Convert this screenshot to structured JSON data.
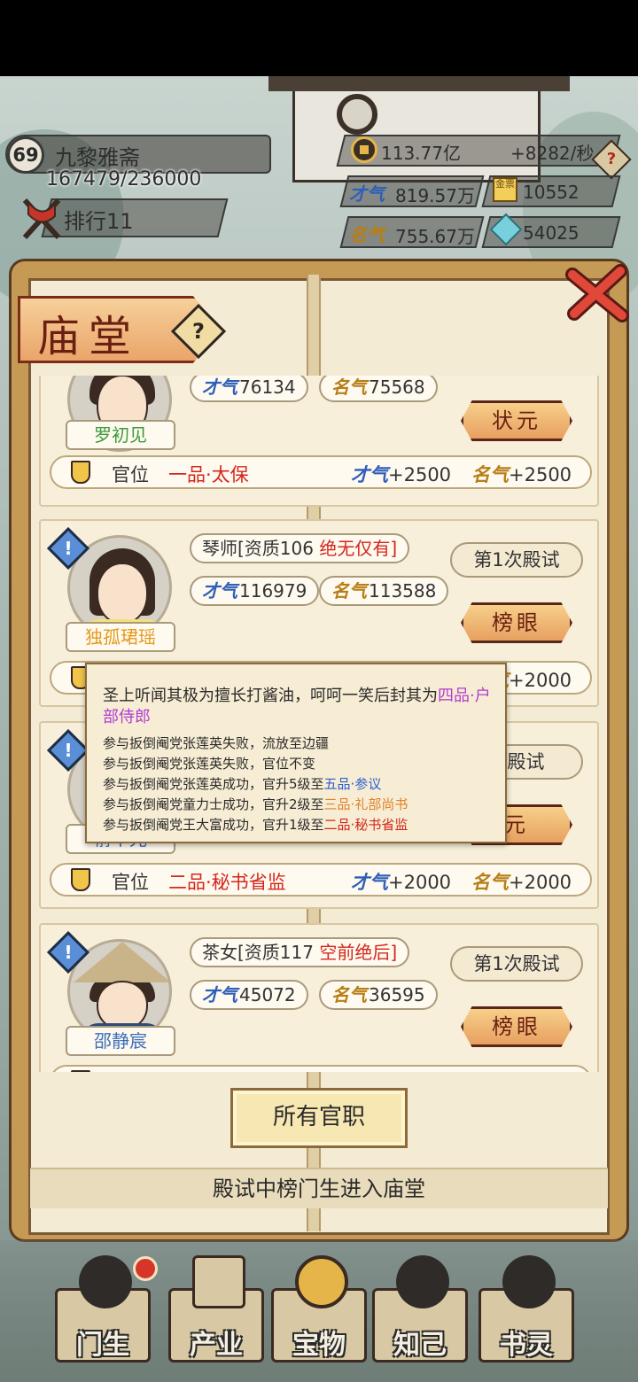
{
  "player": {
    "level": "69",
    "name": "九黎雅斋",
    "exp": "167479/236000",
    "rank": "排行11"
  },
  "resources": {
    "money": "113.77亿",
    "income": "+8282/秒",
    "talent": "819.57万",
    "gold": "10552",
    "fame": "755.67万",
    "gems": "54025"
  },
  "icons": {
    "talent_tag": "才气",
    "fame_tag": "名气",
    "gold_seal": "金票",
    "help": "?",
    "warn": "!"
  },
  "panel": {
    "title": "庙堂",
    "all_positions": "所有官职",
    "footer": "殿试中榜门生进入庙堂"
  },
  "rank_label": "官位",
  "cards": [
    {
      "name": "罗初见",
      "talent": "76134",
      "fame": "75568",
      "honor": "状元",
      "position": "一品·太保",
      "talent_bonus": "+2500",
      "fame_bonus": "+2500"
    },
    {
      "name": "独孤珺瑶",
      "role": "琴师[资质106",
      "quality": "绝无仅有]",
      "exam": "第1次殿试",
      "talent": "116979",
      "fame": "113588",
      "honor": "榜眼",
      "fame_bonus": "+2000"
    },
    {
      "name": "俞华光",
      "exam": "次殿试",
      "honor": "元",
      "position": "二品·秘书省监",
      "talent_bonus": "+2000",
      "fame_bonus": "+2000"
    },
    {
      "name": "邵静宸",
      "role": "茶女[资质117",
      "quality": "空前绝后]",
      "exam": "第1次殿试",
      "talent": "45072",
      "fame": "36595",
      "honor": "榜眼"
    }
  ],
  "tooltip": {
    "main": "圣上听闻其极为擅长打酱油，呵呵一笑后封其为",
    "main_highlight": "四品·户部侍郎",
    "lines": [
      {
        "text": "参与扳倒阉党张莲英失败，流放至边疆",
        "hl": ""
      },
      {
        "text": "参与扳倒阉党张莲英失败，官位不变",
        "hl": ""
      },
      {
        "text": "参与扳倒阉党张莲英成功，官升5级至",
        "hl": "五品·参议"
      },
      {
        "text": "参与扳倒阉党童力士成功，官升2级至",
        "hl": "三品·礼部尚书"
      },
      {
        "text": "参与扳倒阉党王大富成功，官升1级至",
        "hl": "二品·秘书省监"
      }
    ]
  },
  "nav": [
    "门生",
    "产业",
    "宝物",
    "知己",
    "书灵"
  ],
  "colors": {
    "accent_red": "#d4261c",
    "talent_blue": "#2f5fb8",
    "fame_gold": "#b77e16",
    "panel_bg": "#f4ebd4"
  }
}
